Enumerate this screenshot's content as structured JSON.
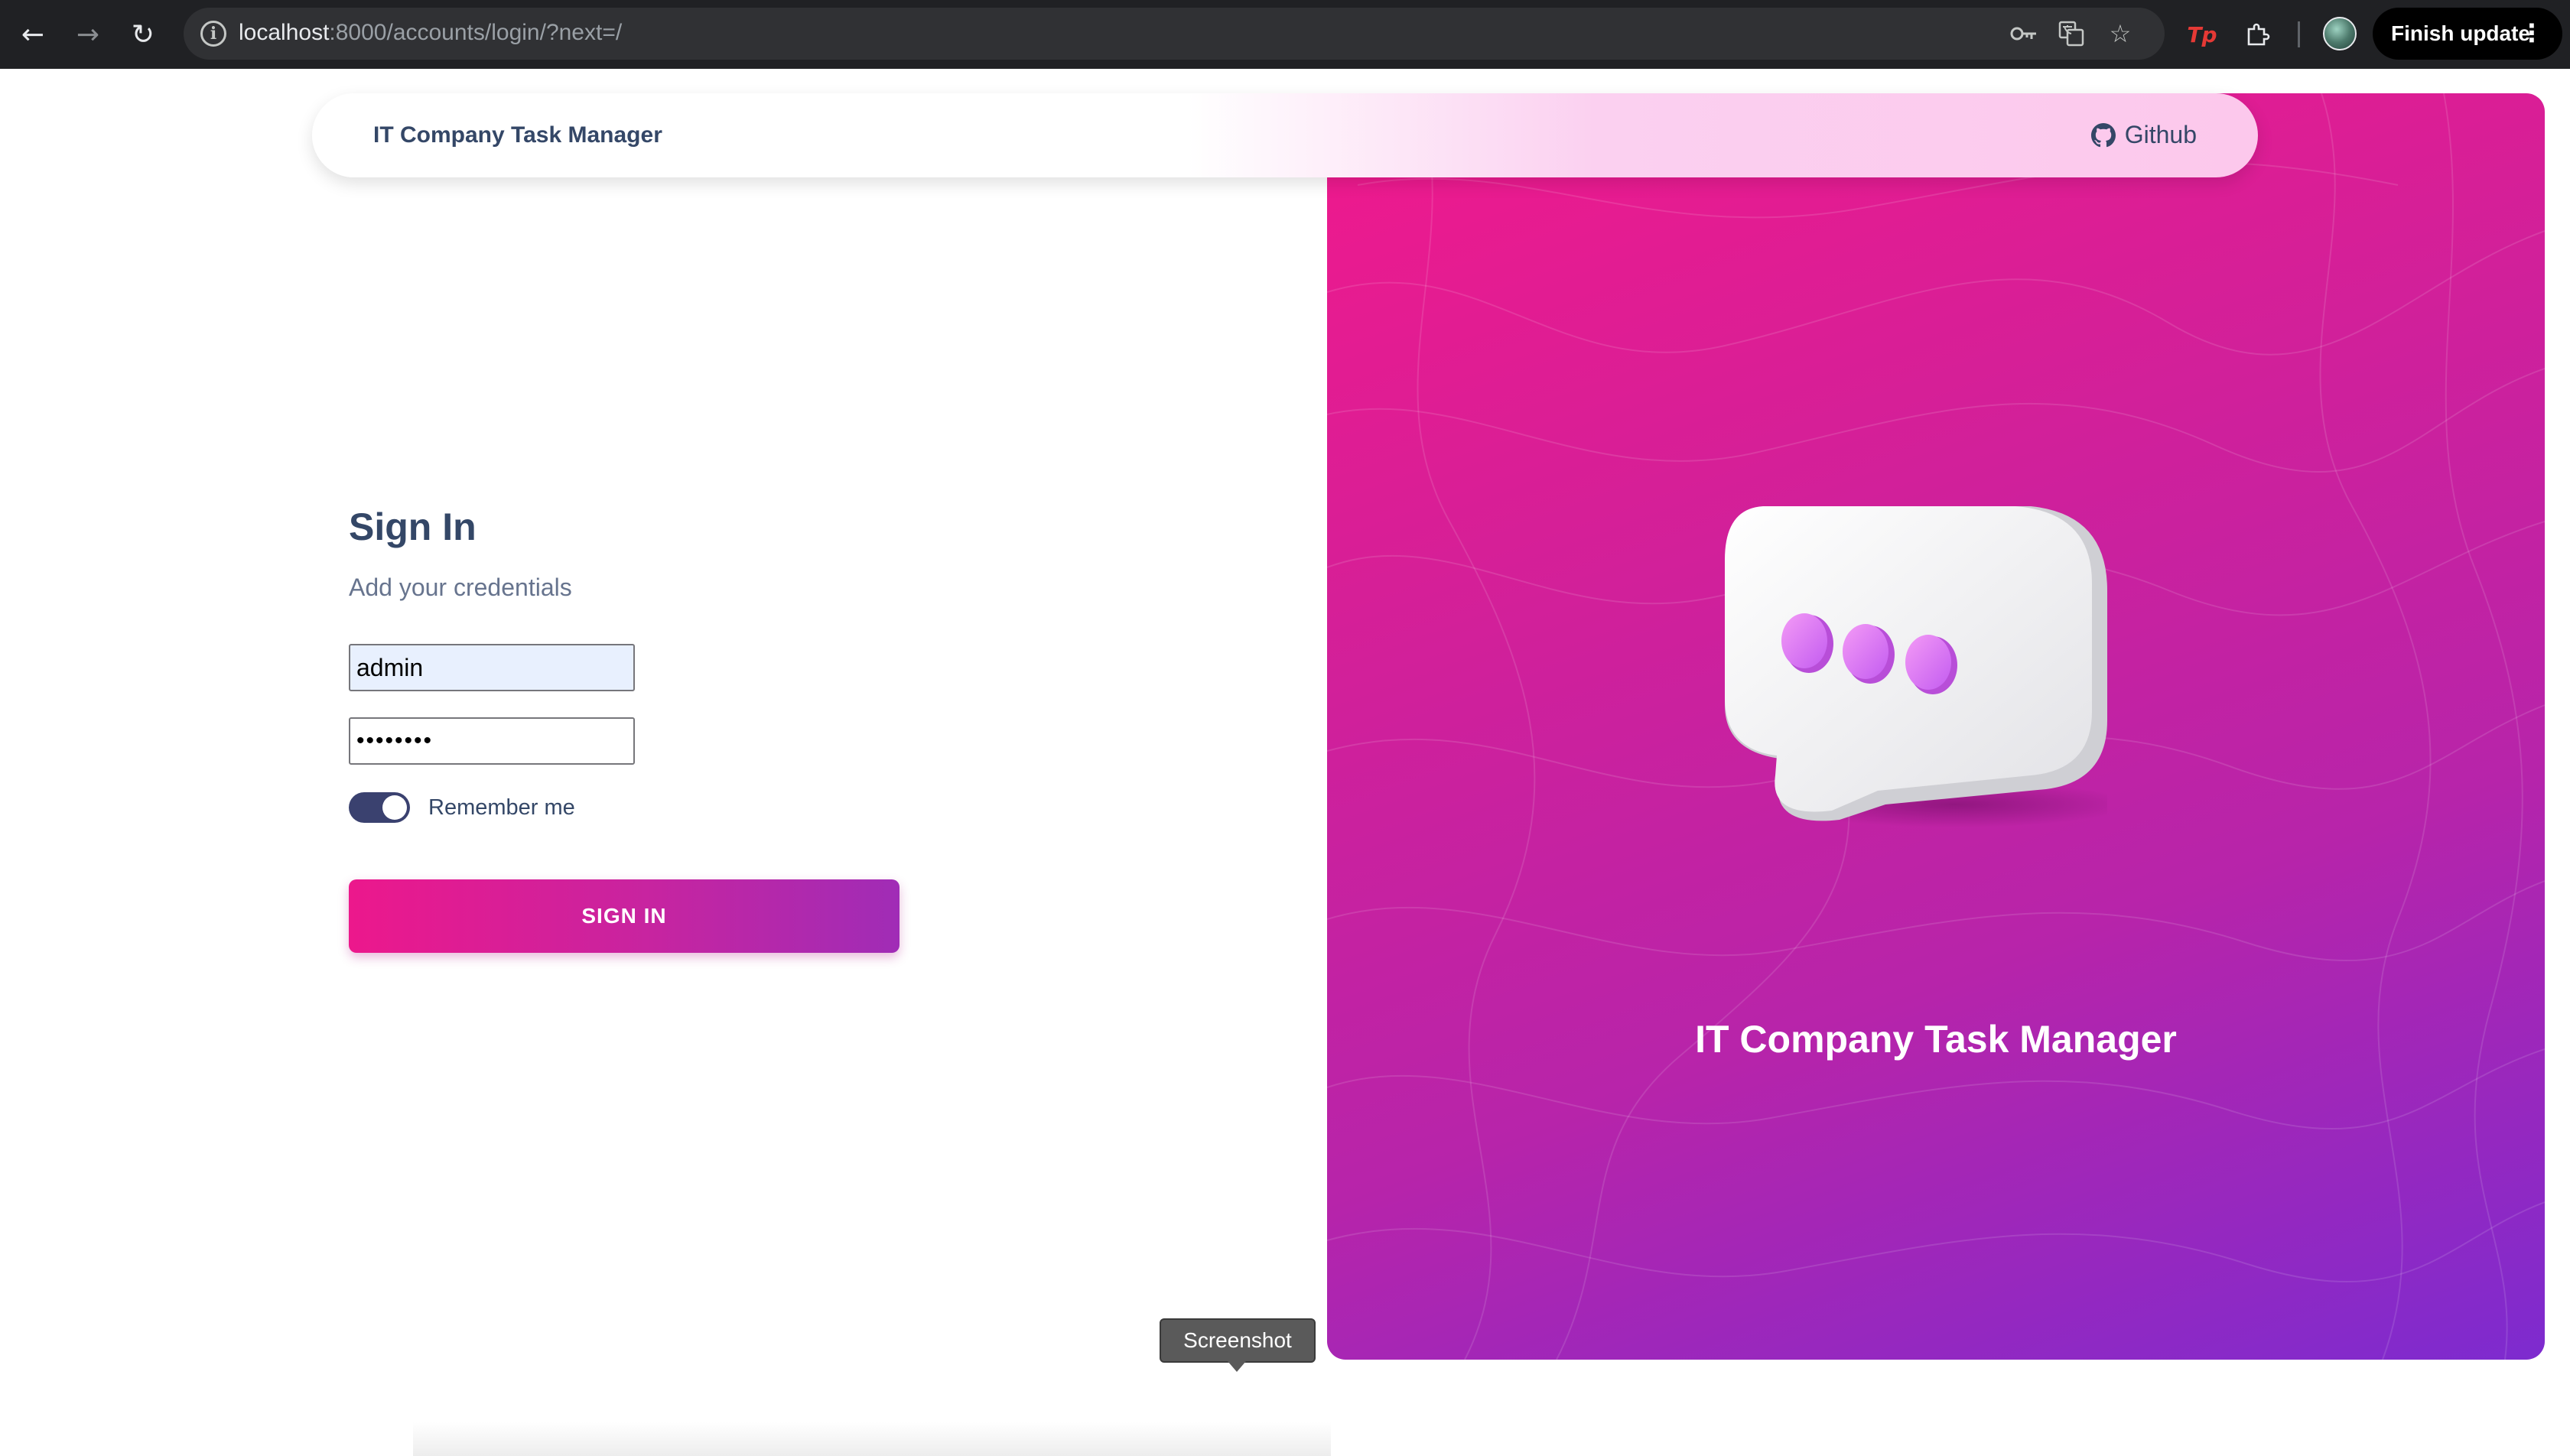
{
  "browser": {
    "url_host": "localhost",
    "url_path": ":8000/accounts/login/?next=/",
    "finish_update_label": "Finish update",
    "tp_label": "Tp"
  },
  "navbar": {
    "brand": "IT Company Task Manager",
    "github_label": "Github"
  },
  "form": {
    "title": "Sign In",
    "subtitle": "Add your credentials",
    "username_value": "admin",
    "password_value": "••••••••",
    "remember_label": "Remember me",
    "remember_checked": true,
    "submit_label": "SIGN IN"
  },
  "hero": {
    "title": "IT Company Task Manager"
  },
  "tooltip": {
    "label": "Screenshot"
  },
  "colors": {
    "brand_text": "#344767",
    "gradient_start": "#f1198c",
    "gradient_end": "#7d2bcf",
    "toggle": "#3a416f"
  }
}
